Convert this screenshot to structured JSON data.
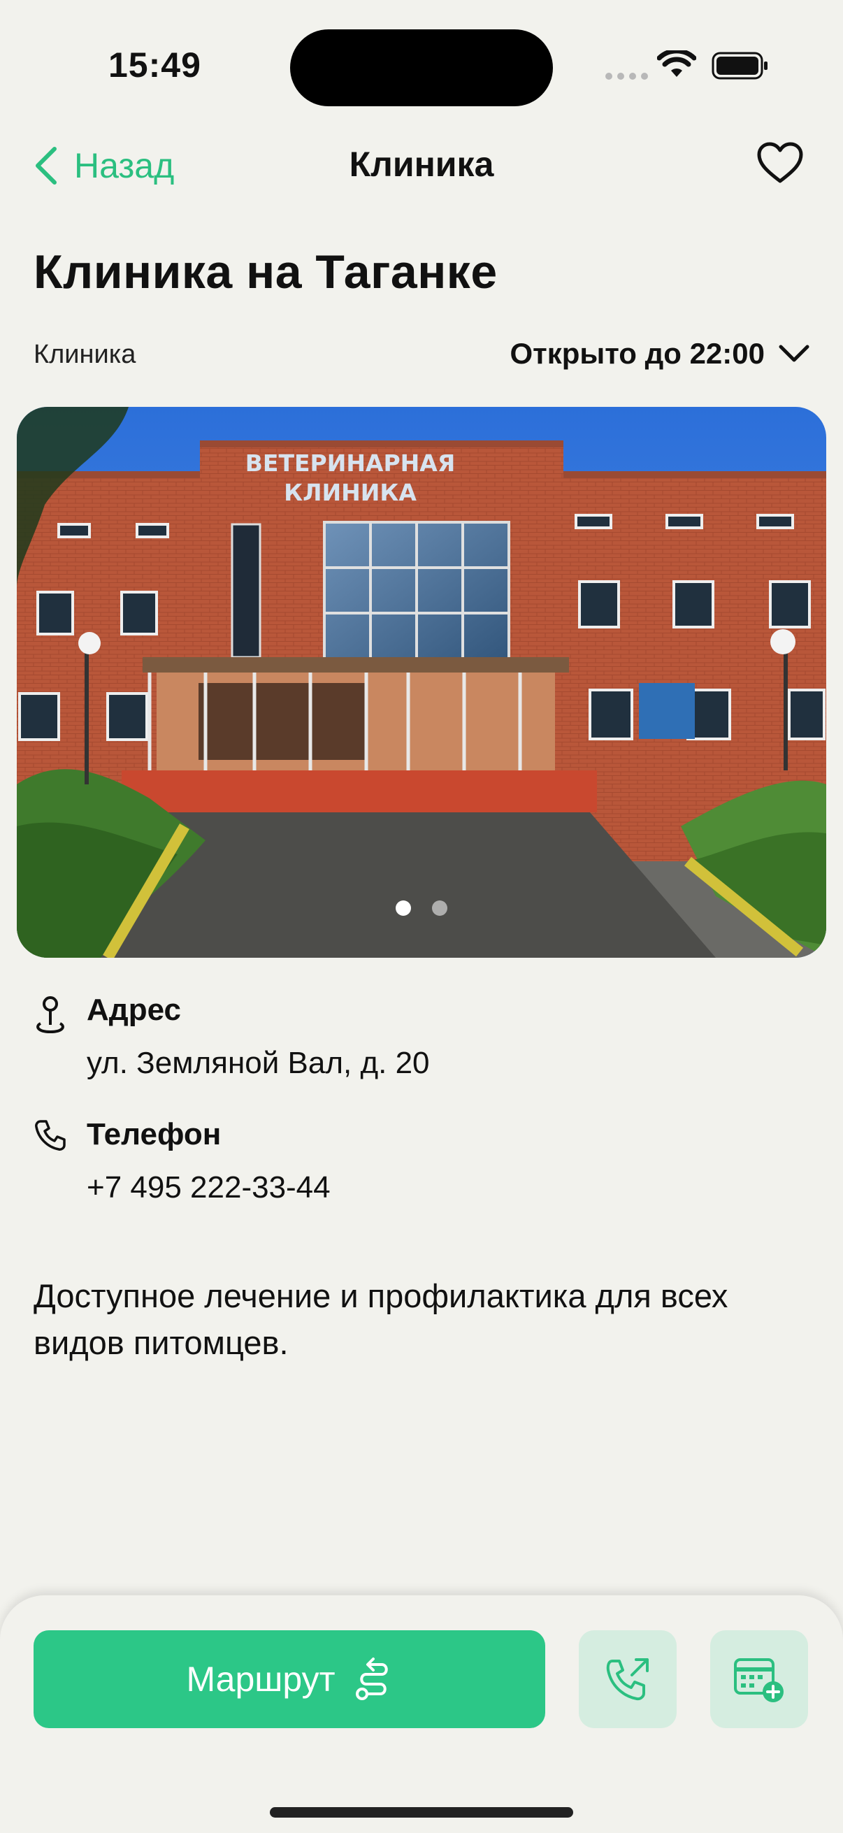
{
  "status": {
    "time": "15:49"
  },
  "nav": {
    "back_label": "Назад",
    "title": "Клиника"
  },
  "clinic": {
    "name": "Клиника на Таганке",
    "category": "Клиника",
    "hours": "Открыто до 22:00",
    "photo_sign_line1": "ВЕТЕРИНАРНАЯ",
    "photo_sign_line2": "КЛИНИКА",
    "photo_pages": 2,
    "photo_current_page": 1
  },
  "address": {
    "label": "Адрес",
    "value": "ул. Земляной Вал, д. 20"
  },
  "phone": {
    "label": "Телефон",
    "value": "+7 495 222-33-44"
  },
  "description": "Доступное лечение и профилактика для всех видов питомцев.",
  "actions": {
    "route_label": "Маршрут"
  },
  "colors": {
    "accent": "#2cc787",
    "accent_light": "#d5ede0",
    "background": "#f2f2ed"
  },
  "icons": [
    "chevron-left-icon",
    "heart-icon",
    "chevron-down-icon",
    "map-pin-icon",
    "phone-icon",
    "route-icon",
    "phone-outgoing-icon",
    "calendar-add-icon",
    "wifi-icon",
    "battery-icon"
  ]
}
